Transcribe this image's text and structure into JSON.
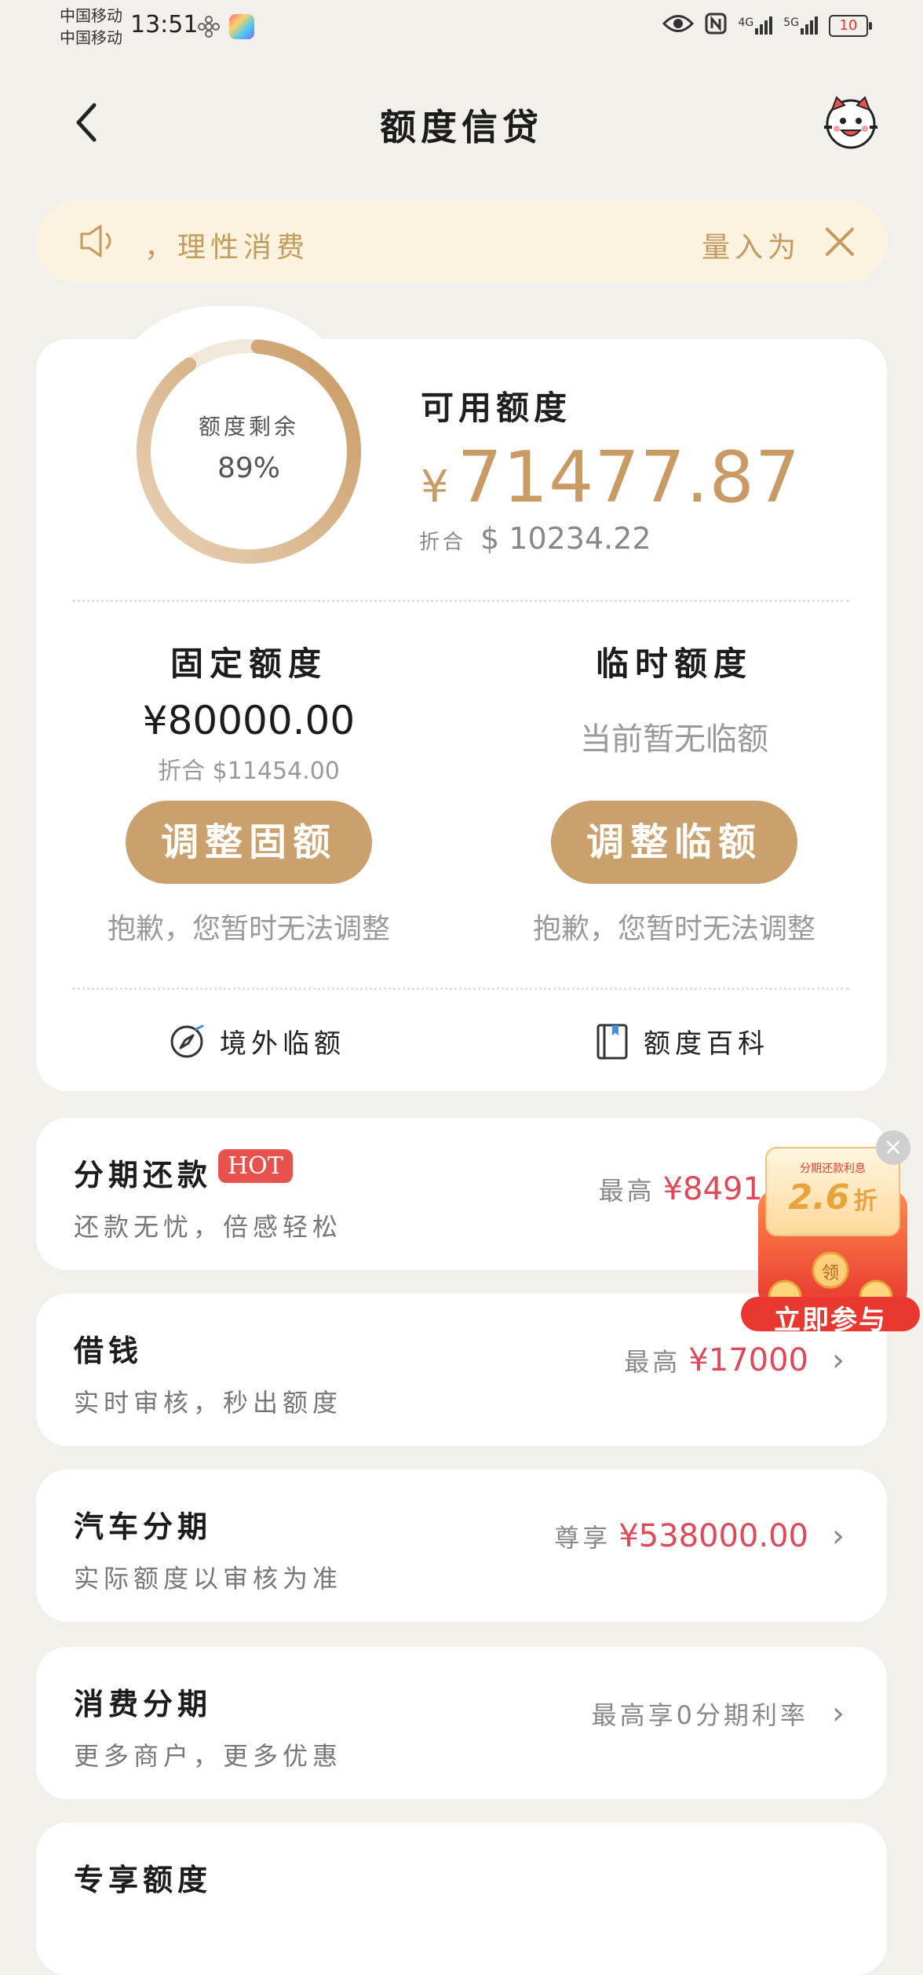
{
  "status_bar": {
    "carrier_line1": "中国移动",
    "carrier_line2": "中国移动",
    "time": "13:51",
    "net1": "4G",
    "net2": "5G",
    "battery": "10"
  },
  "header": {
    "title": "额度信贷",
    "back_icon": "chevron-left-icon",
    "mascot_icon": "mascot-avatar-icon"
  },
  "notice": {
    "text_left": "，理性消费",
    "text_right": "量入为"
  },
  "overview": {
    "ring_label": "额度剩余",
    "ring_percent": "89%",
    "ring_fraction": 0.89,
    "available_label": "可用额度",
    "currency_symbol": "¥",
    "available_amount": "71477.87",
    "converted_label": "折合",
    "converted_amount": "$ 10234.22"
  },
  "fixed_limit": {
    "title": "固定额度",
    "amount": "¥80000.00",
    "converted": "折合 $11454.00",
    "button": "调整固额",
    "note": "抱歉，您暂时无法调整"
  },
  "temp_limit": {
    "title": "临时额度",
    "empty": "当前暂无临额",
    "button": "调整临额",
    "note": "抱歉，您暂时无法调整"
  },
  "links": {
    "overseas": "境外临额",
    "wiki": "额度百科"
  },
  "rows": [
    {
      "title": "分期还款",
      "badge": "HOT",
      "subtitle": "还款无忧，倍感轻松",
      "prefix": "最高",
      "amount": "¥8491.0"
    },
    {
      "title": "借钱",
      "subtitle": "实时审核，秒出额度",
      "prefix": "最高",
      "amount": "¥17000"
    },
    {
      "title": "汽车分期",
      "subtitle": "实际额度以审核为准",
      "prefix": "尊享",
      "amount": "¥538000.00"
    },
    {
      "title": "消费分期",
      "subtitle": "更多商户，更多优惠",
      "prefix": "最高享0分期利率",
      "amount": ""
    },
    {
      "title": "专享额度"
    }
  ],
  "promo": {
    "top_text": "分期还款利息",
    "discount": "2.6",
    "discount_unit": "折",
    "coin_text": "领",
    "cta": "立即参与"
  },
  "colors": {
    "accent": "#caa06d",
    "amount_red": "#e0495a",
    "background": "#f3efea"
  }
}
